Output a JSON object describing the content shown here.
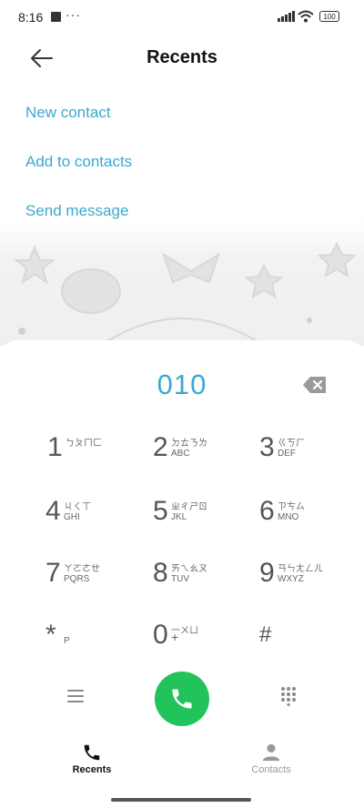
{
  "status": {
    "time": "8:16",
    "overflow": "···",
    "battery": "100"
  },
  "header": {
    "title": "Recents"
  },
  "options": [
    {
      "label": "New contact"
    },
    {
      "label": "Add to contacts"
    },
    {
      "label": "Send message"
    }
  ],
  "dialer": {
    "number": "010",
    "keys": [
      {
        "digit": "1",
        "zhuyin": "ㄅㄆㄇㄈ",
        "letters": ""
      },
      {
        "digit": "2",
        "zhuyin": "ㄉㄊㄋㄌ",
        "letters": "ABC"
      },
      {
        "digit": "3",
        "zhuyin": "ㄍㄎㄏ",
        "letters": "DEF"
      },
      {
        "digit": "4",
        "zhuyin": "ㄐㄑㄒ",
        "letters": "GHI"
      },
      {
        "digit": "5",
        "zhuyin": "ㄓㄔㄕㄖ",
        "letters": "JKL"
      },
      {
        "digit": "6",
        "zhuyin": "ㄗㄘㄙ",
        "letters": "MNO"
      },
      {
        "digit": "7",
        "zhuyin": "ㄚㄛㄜㄝ",
        "letters": "PQRS"
      },
      {
        "digit": "8",
        "zhuyin": "ㄞㄟㄠㄡ",
        "letters": "TUV"
      },
      {
        "digit": "9",
        "zhuyin": "ㄢㄣㄤㄥㄦ",
        "letters": "WXYZ"
      },
      {
        "digit": "*",
        "zhuyin": "",
        "letters": "P"
      },
      {
        "digit": "0",
        "zhuyin": "一ㄨㄩ",
        "letters": "+"
      },
      {
        "digit": "#",
        "zhuyin": "",
        "letters": ""
      }
    ]
  },
  "bottom_nav": [
    {
      "label": "Recents",
      "active": true,
      "icon": "phone-icon"
    },
    {
      "label": "Contacts",
      "active": false,
      "icon": "person-icon"
    }
  ],
  "colors": {
    "accent": "#3aa9d2",
    "call": "#22c35a",
    "key_text": "#555555"
  }
}
